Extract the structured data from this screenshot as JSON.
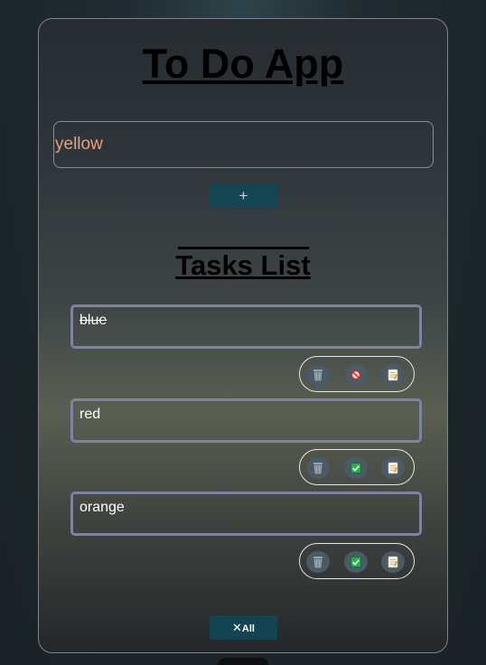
{
  "app": {
    "title": "To Do App"
  },
  "input": {
    "value": "yellow"
  },
  "add_button": {
    "label": "+"
  },
  "tasks_heading": "Tasks List",
  "tasks": [
    {
      "text": "blue",
      "completed": true,
      "toggle_icon": "prohibited-icon"
    },
    {
      "text": "red",
      "completed": false,
      "toggle_icon": "checkbox-checked-icon"
    },
    {
      "text": "orange",
      "completed": false,
      "toggle_icon": "checkbox-checked-icon"
    }
  ],
  "clear_all": {
    "icon": "close-icon",
    "label": "All"
  },
  "colors": {
    "accent": "#144652",
    "task_border": "#7e83a2",
    "input_text": "#e7a07b"
  }
}
